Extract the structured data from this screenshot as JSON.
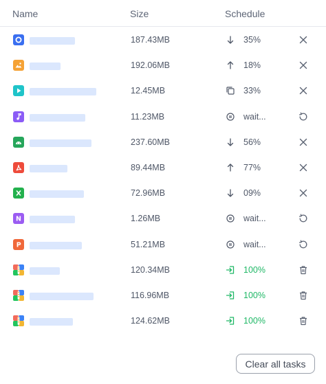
{
  "columns": {
    "name": "Name",
    "size": "Size",
    "schedule": "Schedule"
  },
  "files": [
    {
      "type": "disc-icon",
      "color": "#3a6ff0",
      "size": "187.43MB",
      "status": "download-icon",
      "progress": "35%",
      "action": "close-icon"
    },
    {
      "type": "image-icon",
      "color": "#f5a235",
      "size": "192.06MB",
      "status": "upload-icon",
      "progress": "18%",
      "action": "close-icon"
    },
    {
      "type": "video-icon",
      "color": "#1fc4c9",
      "size": "12.45MB",
      "status": "copy-icon",
      "progress": "33%",
      "action": "close-icon"
    },
    {
      "type": "music-icon",
      "color": "#8b5cf6",
      "size": "11.23MB",
      "status": "pause-icon",
      "progress": "wait...",
      "action": "retry-icon"
    },
    {
      "type": "android-icon",
      "color": "#26a65b",
      "size": "237.60MB",
      "status": "download-icon",
      "progress": "56%",
      "action": "close-icon"
    },
    {
      "type": "pdf-icon",
      "color": "#ee4b3b",
      "size": "89.44MB",
      "status": "upload-icon",
      "progress": "77%",
      "action": "close-icon"
    },
    {
      "type": "excel-icon",
      "color": "#23b14d",
      "size": "72.96MB",
      "status": "download-icon",
      "progress": "09%",
      "action": "close-icon"
    },
    {
      "type": "onenote-icon",
      "color": "#9b5cf2",
      "size": "1.26MB",
      "status": "pause-icon",
      "progress": "wait...",
      "action": "retry-icon"
    },
    {
      "type": "powerpoint-icon",
      "color": "#f0683a",
      "size": "51.21MB",
      "status": "pause-icon",
      "progress": "wait...",
      "action": "retry-icon"
    },
    {
      "type": "archive-icon",
      "color": "#f2b632",
      "size": "120.34MB",
      "status": "complete-icon",
      "progress": "100%",
      "action": "delete-icon"
    },
    {
      "type": "archive-icon",
      "color": "#f2b632",
      "size": "116.96MB",
      "status": "complete-icon",
      "progress": "100%",
      "action": "delete-icon"
    },
    {
      "type": "archive-icon",
      "color": "#f2b632",
      "size": "124.62MB",
      "status": "complete-icon",
      "progress": "100%",
      "action": "delete-icon"
    }
  ],
  "clear_all_label": "Clear all tasks",
  "colors": {
    "accent_green": "#1fb866",
    "name_placeholder": "#dbe7fd",
    "icon_gray": "#4f5767"
  }
}
